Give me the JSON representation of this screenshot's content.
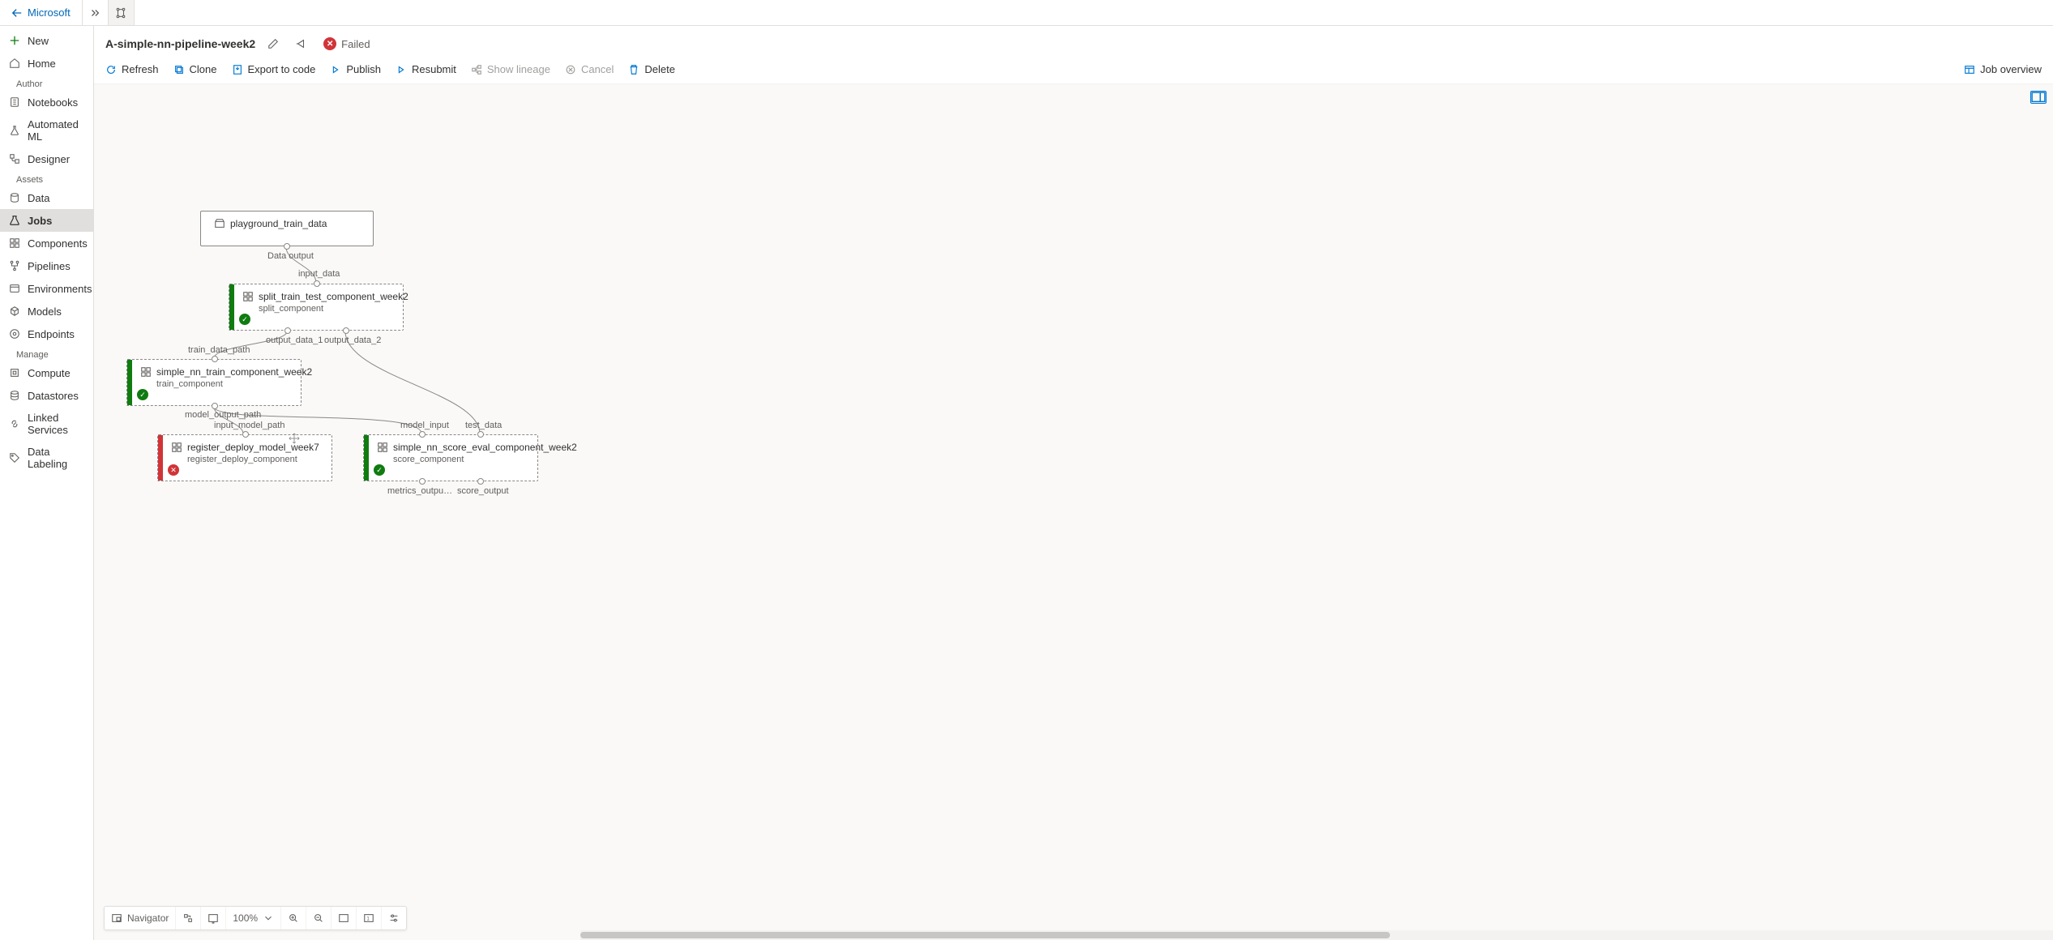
{
  "workspace": {
    "name": "Microsoft"
  },
  "sidebar": {
    "new": "New",
    "home": "Home",
    "groups": {
      "author": "Author",
      "assets": "Assets",
      "manage": "Manage"
    },
    "author": {
      "notebooks": "Notebooks",
      "automl": "Automated ML",
      "designer": "Designer"
    },
    "assets": {
      "data": "Data",
      "jobs": "Jobs",
      "components": "Components",
      "pipelines": "Pipelines",
      "environments": "Environments",
      "models": "Models",
      "endpoints": "Endpoints"
    },
    "manage": {
      "compute": "Compute",
      "datastores": "Datastores",
      "linked": "Linked Services",
      "labeling": "Data Labeling"
    }
  },
  "header": {
    "pipeline_name": "A-simple-nn-pipeline-week2",
    "status": "Failed"
  },
  "toolbar": {
    "refresh": "Refresh",
    "clone": "Clone",
    "export": "Export to code",
    "publish": "Publish",
    "resubmit": "Resubmit",
    "lineage": "Show lineage",
    "cancel": "Cancel",
    "delete": "Delete",
    "overview": "Job overview"
  },
  "nodes": {
    "n0": {
      "title": "playground_train_data",
      "out0": "Data output"
    },
    "n1": {
      "title": "split_train_test_component_week2",
      "sub": "split_component",
      "in0": "input_data",
      "out0": "output_data_1",
      "out1": "output_data_2"
    },
    "n2": {
      "title": "simple_nn_train_component_week2",
      "sub": "train_component",
      "in0": "train_data_path",
      "out0": "model_output_path"
    },
    "n3": {
      "title": "register_deploy_model_week7",
      "sub": "register_deploy_component",
      "in0": "input_model_path"
    },
    "n4": {
      "title": "simple_nn_score_eval_component_week2",
      "sub": "score_component",
      "in0": "model_input",
      "in1": "test_data",
      "out0": "metrics_outpu…",
      "out1": "score_output"
    }
  },
  "bottom": {
    "navigator": "Navigator",
    "zoom": "100%"
  }
}
